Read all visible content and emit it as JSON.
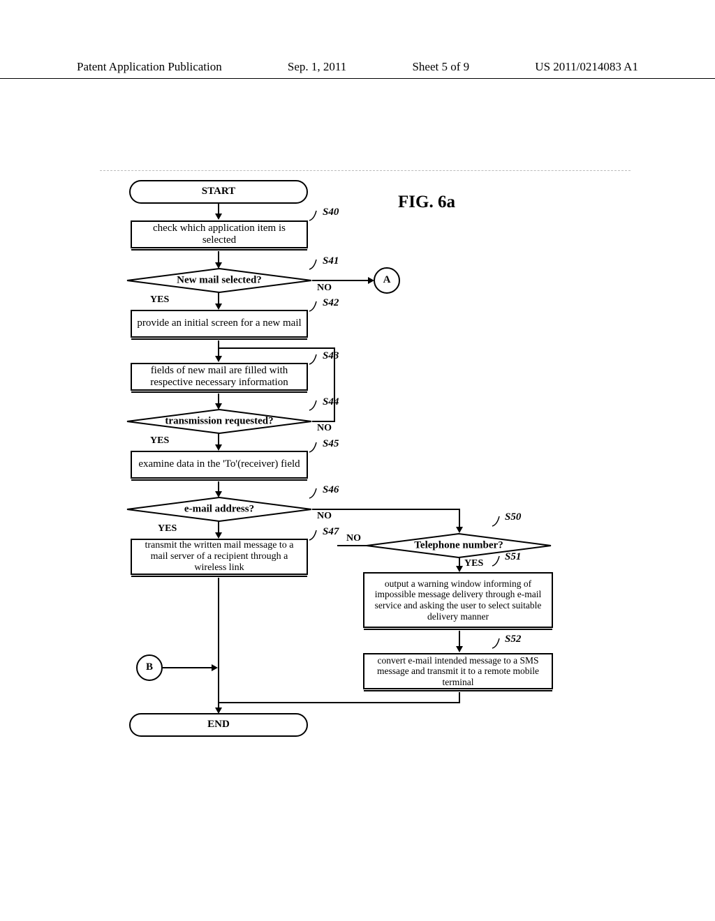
{
  "header": {
    "left": "Patent Application Publication",
    "date": "Sep. 1, 2011",
    "sheet": "Sheet 5 of 9",
    "pubno": "US 2011/0214083 A1"
  },
  "figure_title": "FIG. 6a",
  "terminals": {
    "start": "START",
    "end": "END"
  },
  "connectors": {
    "a": "A",
    "b": "B"
  },
  "steps": {
    "s40": {
      "id": "S40",
      "text": "check which application item is selected"
    },
    "s41": {
      "id": "S41",
      "text": "New mail selected?"
    },
    "s42": {
      "id": "S42",
      "text": "provide an initial screen  for a new mail"
    },
    "s43": {
      "id": "S43",
      "text": "fields of new mail are  filled with respective necessary information"
    },
    "s44": {
      "id": "S44",
      "text": "transmission requested?"
    },
    "s45": {
      "id": "S45",
      "text": "examine data in the 'To'(receiver) field"
    },
    "s46": {
      "id": "S46",
      "text": "e-mail address?"
    },
    "s47": {
      "id": "S47",
      "text": "transmit the written mail message to a mail server of a recipient through a wireless link"
    },
    "s50": {
      "id": "S50",
      "text": "Telephone number?"
    },
    "s51": {
      "id": "S51",
      "text": "output a warning window informing of impossible message delivery through e-mail service and asking the user to select suitable delivery manner"
    },
    "s52": {
      "id": "S52",
      "text": "convert e-mail intended message to a SMS message and transmit it to a remote mobile terminal"
    }
  },
  "edge_labels": {
    "yes": "YES",
    "no": "NO"
  }
}
